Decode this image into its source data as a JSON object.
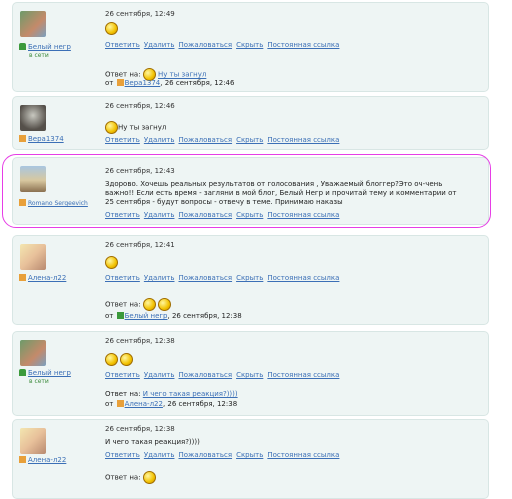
{
  "actions": [
    "Ответить",
    "Удалить",
    "Пожаловаться",
    "Скрыть",
    "Постоянная ссылка"
  ],
  "reply_prefix": "Ответ на:",
  "from_prefix": "от",
  "comments": [
    {
      "user": "Белый негр",
      "online": "в сети",
      "date": "26 сентября, 12:49",
      "reply": {
        "text": "Ну ты загнул",
        "from_user": "Bepa1374",
        "from_date": ", 26 сентября, 12:46"
      }
    },
    {
      "user": "Bepa1374",
      "date": "26 сентября, 12:46",
      "text": "Ну ты загнул"
    },
    {
      "user": "Romano Sergeevich",
      "date": "26 сентября, 12:43",
      "text": "Здорово. Хочешь реальных результатов от голосования , Уважаемый блоггер?Это оч-чень важно!! Если есть время - загляни в мой блог, Белый Негр и прочитай тему и комментарии от 25 сентября - будут вопросы - отвечу в теме. Принимаю наказы"
    },
    {
      "user": "Алена-л22",
      "date": "26 сентября, 12:41",
      "reply": {
        "from_user": "Белый негр",
        "from_date": ", 26 сентября, 12:38"
      }
    },
    {
      "user": "Белый негр",
      "online": "в сети",
      "date": "26 сентября, 12:38",
      "reply": {
        "text": "И чего такая реакция?))))",
        "from_user": "Алена-л22",
        "from_date": ", 26 сентября, 12:38"
      }
    },
    {
      "user": "Алена-л22",
      "date": "26 сентября, 12:38",
      "text": "И чего такая реакция?))))"
    }
  ],
  "colors": {
    "link": "#3b6fb6",
    "card_bg": "#eef5f4",
    "highlight": "#e63de6",
    "online": "#3a8a3a"
  }
}
